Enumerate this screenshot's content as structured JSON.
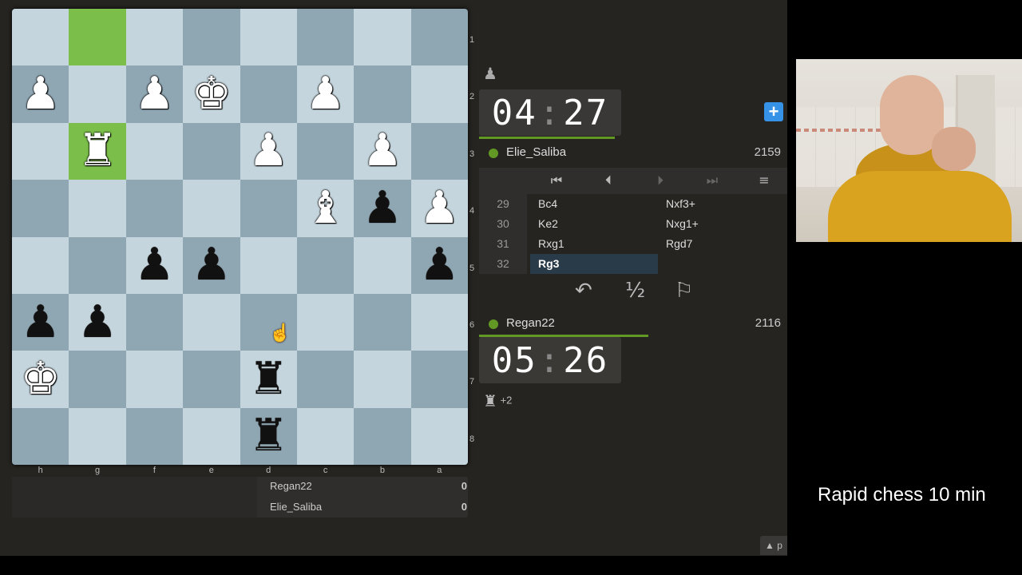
{
  "board": {
    "ranks": [
      "1",
      "2",
      "3",
      "4",
      "5",
      "6",
      "7",
      "8"
    ],
    "files": [
      "h",
      "g",
      "f",
      "e",
      "d",
      "c",
      "b",
      "a"
    ],
    "highlight_squares": [
      "g1",
      "g3"
    ],
    "pieces": [
      {
        "square": "h2",
        "type": "pawn",
        "color": "white",
        "glyph": "♟"
      },
      {
        "square": "f2",
        "type": "pawn",
        "color": "white",
        "glyph": "♟"
      },
      {
        "square": "e2",
        "type": "king",
        "color": "white",
        "glyph": "♚"
      },
      {
        "square": "c2",
        "type": "pawn",
        "color": "white",
        "glyph": "♟"
      },
      {
        "square": "g3",
        "type": "rook",
        "color": "white",
        "glyph": "♜"
      },
      {
        "square": "d3",
        "type": "pawn",
        "color": "white",
        "glyph": "♟"
      },
      {
        "square": "b3",
        "type": "pawn",
        "color": "white",
        "glyph": "♟"
      },
      {
        "square": "c4",
        "type": "bishop",
        "color": "white",
        "glyph": "♝"
      },
      {
        "square": "b4",
        "type": "pawn",
        "color": "black",
        "glyph": "♟"
      },
      {
        "square": "a4",
        "type": "pawn",
        "color": "white",
        "glyph": "♟"
      },
      {
        "square": "f5",
        "type": "pawn",
        "color": "black",
        "glyph": "♟"
      },
      {
        "square": "e5",
        "type": "pawn",
        "color": "black",
        "glyph": "♟"
      },
      {
        "square": "a5",
        "type": "pawn",
        "color": "black",
        "glyph": "♟"
      },
      {
        "square": "h6",
        "type": "pawn",
        "color": "black",
        "glyph": "♟"
      },
      {
        "square": "g6",
        "type": "pawn",
        "color": "black",
        "glyph": "♟"
      },
      {
        "square": "h7",
        "type": "king",
        "color": "white",
        "glyph": "♚"
      },
      {
        "square": "d7",
        "type": "rook",
        "color": "black",
        "glyph": "♜"
      },
      {
        "square": "d8",
        "type": "rook",
        "color": "black",
        "glyph": "♜"
      }
    ]
  },
  "crosstable": {
    "rows": [
      {
        "name": "Regan22",
        "score": "0"
      },
      {
        "name": "Elie_Saliba",
        "score": "0"
      }
    ]
  },
  "top_player": {
    "captured_icon": "pawn-icon",
    "clock": {
      "min": "04",
      "sec": "27"
    },
    "clock_progress": 0.44,
    "name": "Elie_Saliba",
    "rating": "2159",
    "online_color": "#629924"
  },
  "bottom_player": {
    "clock": {
      "min": "05",
      "sec": "26"
    },
    "clock_progress": 0.55,
    "name": "Regan22",
    "rating": "2116",
    "material_diff": "+2"
  },
  "add_time_label": "+",
  "move_nav": {
    "first": "⏮",
    "prev": "⏴",
    "next": "⏵",
    "last": "⏭",
    "menu": "≡"
  },
  "moves": [
    {
      "num": "29",
      "white": "Bc4",
      "black": "Nxf3+"
    },
    {
      "num": "30",
      "white": "Ke2",
      "black": "Nxg1+"
    },
    {
      "num": "31",
      "white": "Rxg1",
      "black": "Rgd7"
    },
    {
      "num": "32",
      "white": "Rg3",
      "black": ""
    }
  ],
  "controls": {
    "takeback": "↶",
    "draw": "½",
    "resign": "⚐"
  },
  "collapse_label": "▲ p",
  "caption": "Rapid chess 10 min",
  "colors": {
    "board_light": "#c5d5dd",
    "board_dark": "#8fa6b3",
    "highlight": "#7bbf4a",
    "accent_blue": "#3692e7"
  }
}
